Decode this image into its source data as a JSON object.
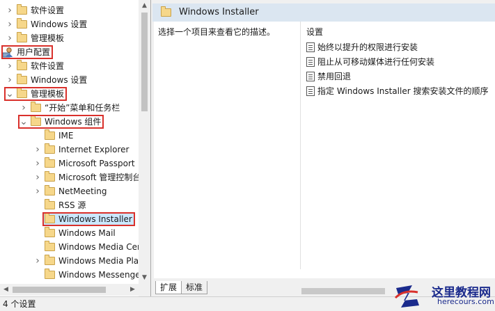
{
  "tree": {
    "items": [
      {
        "label": "软件设置",
        "chevron": "right",
        "indent": 8,
        "icon": "folder"
      },
      {
        "label": "Windows 设置",
        "chevron": "right",
        "indent": 8,
        "icon": "folder"
      },
      {
        "label": "管理模板",
        "chevron": "right",
        "indent": 8,
        "icon": "folder"
      },
      {
        "label": "用户配置",
        "chevron": "none",
        "indent": 0,
        "icon": "user",
        "highlighted": true
      },
      {
        "label": "软件设置",
        "chevron": "right",
        "indent": 8,
        "icon": "folder"
      },
      {
        "label": "Windows 设置",
        "chevron": "right",
        "indent": 8,
        "icon": "folder"
      },
      {
        "label": "管理模板",
        "chevron": "down",
        "indent": 8,
        "icon": "folder",
        "highlighted": true
      },
      {
        "label": "“开始”菜单和任务栏",
        "chevron": "right",
        "indent": 28,
        "icon": "folder"
      },
      {
        "label": "Windows 组件",
        "chevron": "down",
        "indent": 28,
        "icon": "folder",
        "highlighted": true
      },
      {
        "label": "IME",
        "chevron": "none",
        "indent": 48,
        "icon": "folder"
      },
      {
        "label": "Internet Explorer",
        "chevron": "right",
        "indent": 48,
        "icon": "folder"
      },
      {
        "label": "Microsoft Passport",
        "chevron": "right",
        "indent": 48,
        "icon": "folder"
      },
      {
        "label": "Microsoft 管理控制台",
        "chevron": "right",
        "indent": 48,
        "icon": "folder"
      },
      {
        "label": "NetMeeting",
        "chevron": "right",
        "indent": 48,
        "icon": "folder"
      },
      {
        "label": "RSS 源",
        "chevron": "none",
        "indent": 48,
        "icon": "folder"
      },
      {
        "label": "Windows Installer",
        "chevron": "none",
        "indent": 48,
        "icon": "folder",
        "selected": true,
        "highlighted": true
      },
      {
        "label": "Windows Mail",
        "chevron": "none",
        "indent": 48,
        "icon": "folder"
      },
      {
        "label": "Windows Media Center",
        "chevron": "none",
        "indent": 48,
        "icon": "folder"
      },
      {
        "label": "Windows Media Player",
        "chevron": "right",
        "indent": 48,
        "icon": "folder"
      },
      {
        "label": "Windows Messenger",
        "chevron": "none",
        "indent": 48,
        "icon": "folder"
      }
    ]
  },
  "right_pane": {
    "header_title": "Windows Installer",
    "description": "选择一个项目来查看它的描述。",
    "settings_header": "设置",
    "settings": [
      "始终以提升的权限进行安装",
      "阻止从可移动媒体进行任何安装",
      "禁用回退",
      "指定 Windows Installer 搜索安装文件的顺序"
    ],
    "tabs": [
      "扩展",
      "标准"
    ],
    "active_tab": "扩展"
  },
  "status_bar": {
    "text": "4 个设置"
  },
  "watermark": {
    "title": "这里教程网",
    "url": "herecours.com"
  },
  "colors": {
    "highlight_box": "#d9302b",
    "selection_bg": "#cce8ff",
    "header_bg": "#dbe6f1",
    "folder": "#f6d78a",
    "watermark": "#1a2a8c"
  },
  "icons": {
    "folder": "folder-icon",
    "user": "user-config-icon",
    "chevron_right": "chevron-right-icon",
    "chevron_down": "chevron-down-icon",
    "setting": "policy-setting-icon"
  }
}
